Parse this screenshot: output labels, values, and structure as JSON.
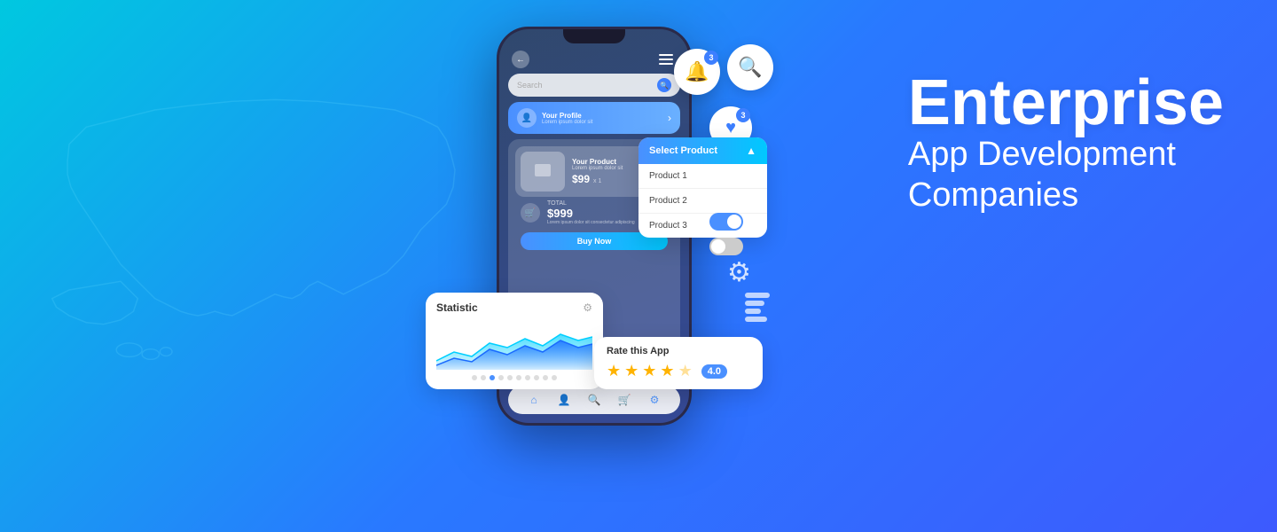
{
  "background": {
    "gradient_start": "#00c8e0",
    "gradient_end": "#3d5afe"
  },
  "enterprise": {
    "title": "Enterprise",
    "subtitle_line1": "App Development",
    "subtitle_line2": "Companies"
  },
  "phone": {
    "search_placeholder": "Search",
    "profile_title": "Your Profile",
    "profile_subtitle": "Lorem ipsum dolor sit",
    "product_title": "Your Product",
    "product_subtitle": "Lorem ipsum dolor sit",
    "product_price": "$99",
    "product_qty": "x 1",
    "total_label": "TOTAL",
    "total_price": "$999",
    "total_desc": "Lorem ipsum dolor sit consectetur adipiscing",
    "buy_button": "Buy Now"
  },
  "notifications": {
    "bell_count": "3",
    "heart_count": "3"
  },
  "select_product": {
    "title": "Select Product",
    "options": [
      "Product 1",
      "Product 2",
      "Product 3"
    ]
  },
  "statistic": {
    "title": "Statistic",
    "dots": [
      false,
      false,
      true,
      false,
      false,
      false,
      false,
      false,
      false,
      false
    ]
  },
  "rate_app": {
    "title": "Rate this App",
    "stars": 4,
    "score": "4.0"
  }
}
